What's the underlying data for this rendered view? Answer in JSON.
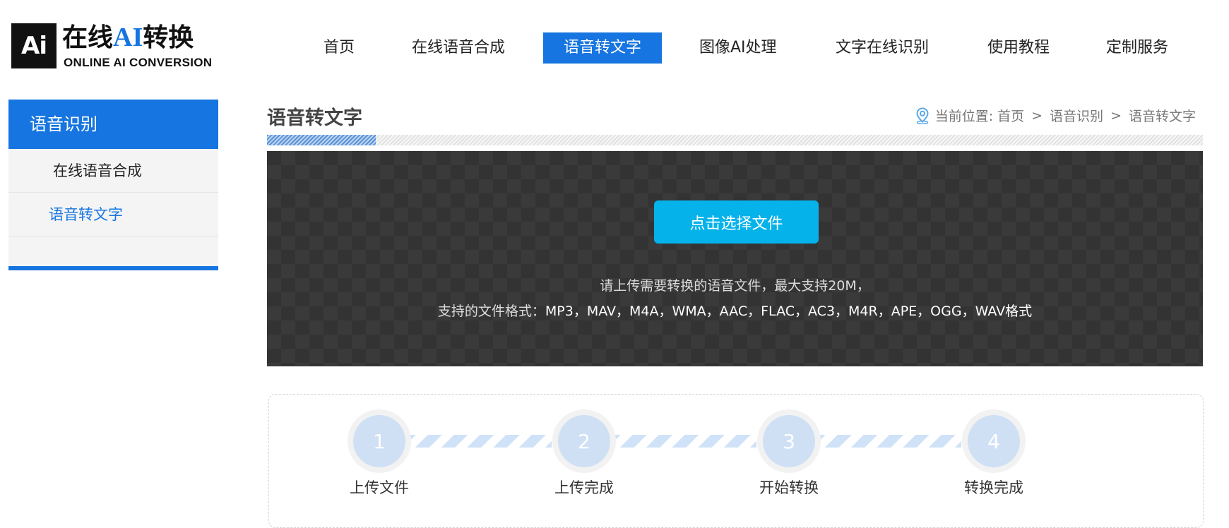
{
  "logo": {
    "box_text": "Ai",
    "cn_pre": "在线",
    "cn_ai": "AI",
    "cn_post": "转换",
    "en": "ONLINE AI CONVERSION"
  },
  "nav": {
    "items": [
      {
        "label": "首页"
      },
      {
        "label": "在线语音合成"
      },
      {
        "label": "语音转文字",
        "active": true
      },
      {
        "label": "图像AI处理"
      },
      {
        "label": "文字在线识别"
      },
      {
        "label": "使用教程"
      },
      {
        "label": "定制服务"
      }
    ]
  },
  "sidebar": {
    "title": "语音识别",
    "items": [
      {
        "label": "在线语音合成"
      },
      {
        "label": "语音转文字",
        "active": true
      }
    ]
  },
  "main": {
    "title": "语音转文字",
    "breadcrumb": {
      "prefix": "当前位置:",
      "items": [
        "首页",
        "语音识别",
        "语音转文字"
      ],
      "separator": ">"
    },
    "upload": {
      "button_label": "点击选择文件",
      "hint_line1": "请上传需要转换的语音文件，最大支持20M，",
      "hint_line2_prefix": "支持的文件格式：",
      "hint_line2_formats": "MP3，MAV，M4A，WMA，AAC，FLAC，AC3，M4R，APE，OGG，WAV格式"
    },
    "steps": [
      {
        "number": "1",
        "label": "上传文件"
      },
      {
        "number": "2",
        "label": "上传完成"
      },
      {
        "number": "3",
        "label": "开始转换"
      },
      {
        "number": "4",
        "label": "转换完成"
      }
    ]
  },
  "colors": {
    "brand_blue": "#1675e0",
    "upload_button": "#05b2ea",
    "upload_bg": "#333333",
    "step_circle": "#cfe0f5"
  },
  "icons": {
    "breadcrumb": "location-pin-icon"
  }
}
